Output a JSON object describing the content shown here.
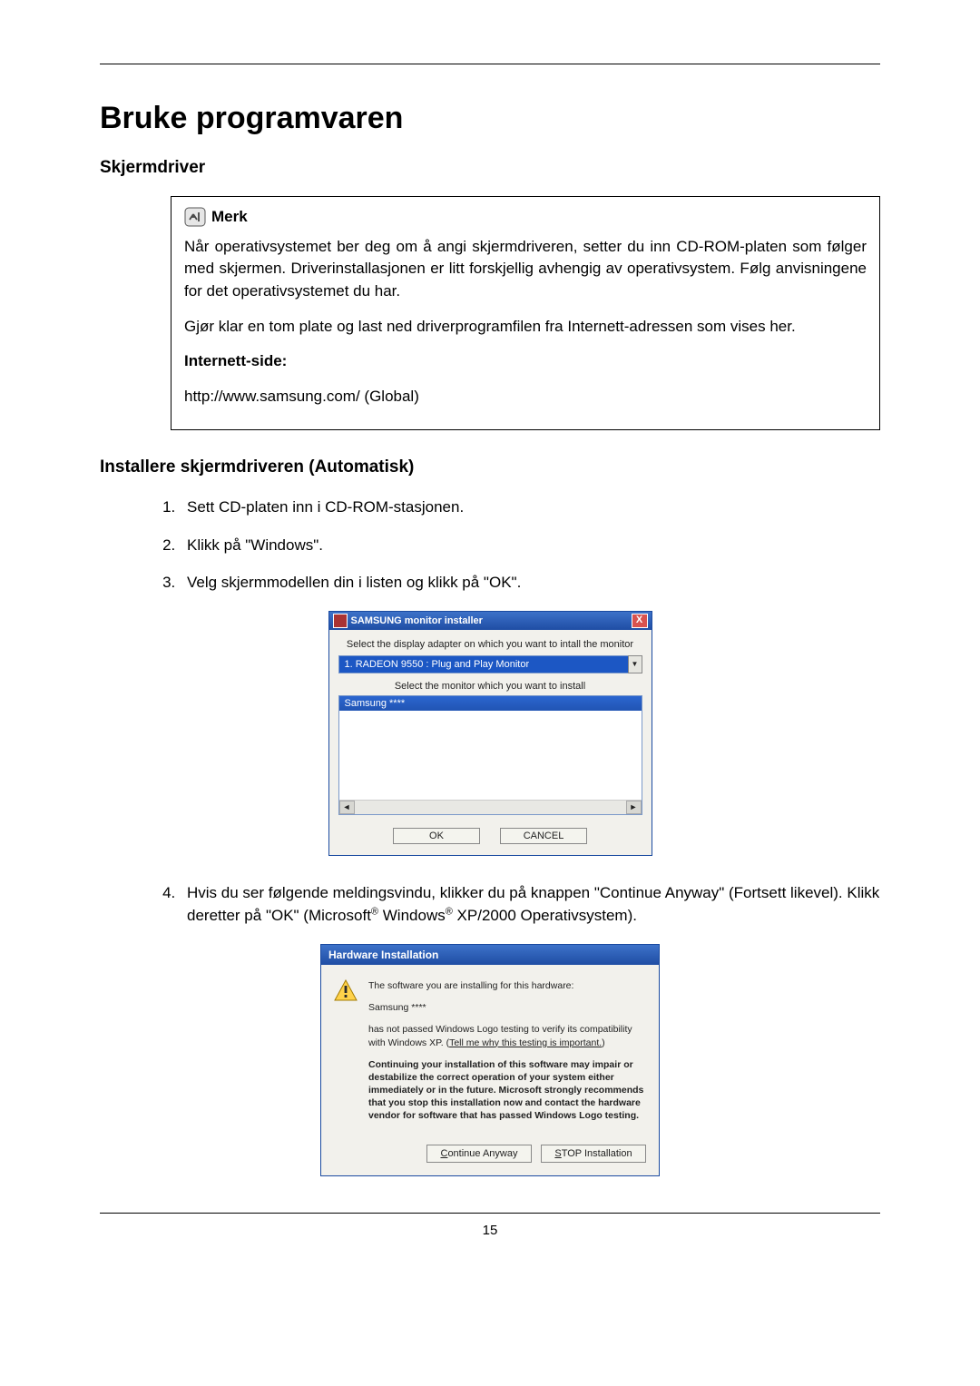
{
  "page_title": "Bruke programvaren",
  "h2": "Skjermdriver",
  "note": {
    "icon_name": "note-icon",
    "title": "Merk",
    "p1": "Når operativsystemet ber deg om å angi skjermdriveren, setter du inn CD-ROM-platen som følger med skjermen. Driverinstallasjonen er litt forskjellig avhengig av operativsystem. Følg anvisningene for det operativsystemet du har.",
    "p2": "Gjør klar en tom plate og last ned driverprogramfilen fra Internett-adressen som vises her.",
    "label": "Internett-side:",
    "url": "http://www.samsung.com/ (Global)"
  },
  "h3": "Installere skjermdriveren (Automatisk)",
  "steps": {
    "1": "Sett CD-platen inn i CD-ROM-stasjonen.",
    "2": "Klikk på \"Windows\".",
    "3": "Velg skjermmodellen din i listen og klikk på \"OK\".",
    "4a": "Hvis du ser følgende meldingsvindu, klikker du på knappen \"Continue Anyway\" (Fortsett likevel). Klikk deretter på \"OK\" (Microsoft",
    "4b": " Windows",
    "4c": " XP/2000 Operativsystem).",
    "reg": "®"
  },
  "installer": {
    "title": "SAMSUNG monitor installer",
    "prompt1": "Select the display adapter on which you want to intall the monitor",
    "adapter": "1. RADEON 9550 : Plug and Play Monitor",
    "prompt2": "Select the monitor which you want to install",
    "selected": "Samsung ****",
    "ok": "OK",
    "cancel": "CANCEL",
    "close": "X"
  },
  "hw": {
    "title": "Hardware Installation",
    "line1": "The software you are installing for this hardware:",
    "device": "Samsung ****",
    "line2a": "has not passed Windows Logo testing to verify its compatibility with Windows XP. (",
    "link": "Tell me why this testing is important.",
    "line2b": ")",
    "warn": "Continuing your installation of this software may impair or destabilize the correct operation of your system either immediately or in the future. Microsoft strongly recommends that you stop this installation now and contact the hardware vendor for software that has passed Windows Logo testing.",
    "btn_continue_u": "C",
    "btn_continue_rest": "ontinue Anyway",
    "btn_stop_u": "S",
    "btn_stop_rest": "TOP Installation"
  },
  "page_number": "15"
}
